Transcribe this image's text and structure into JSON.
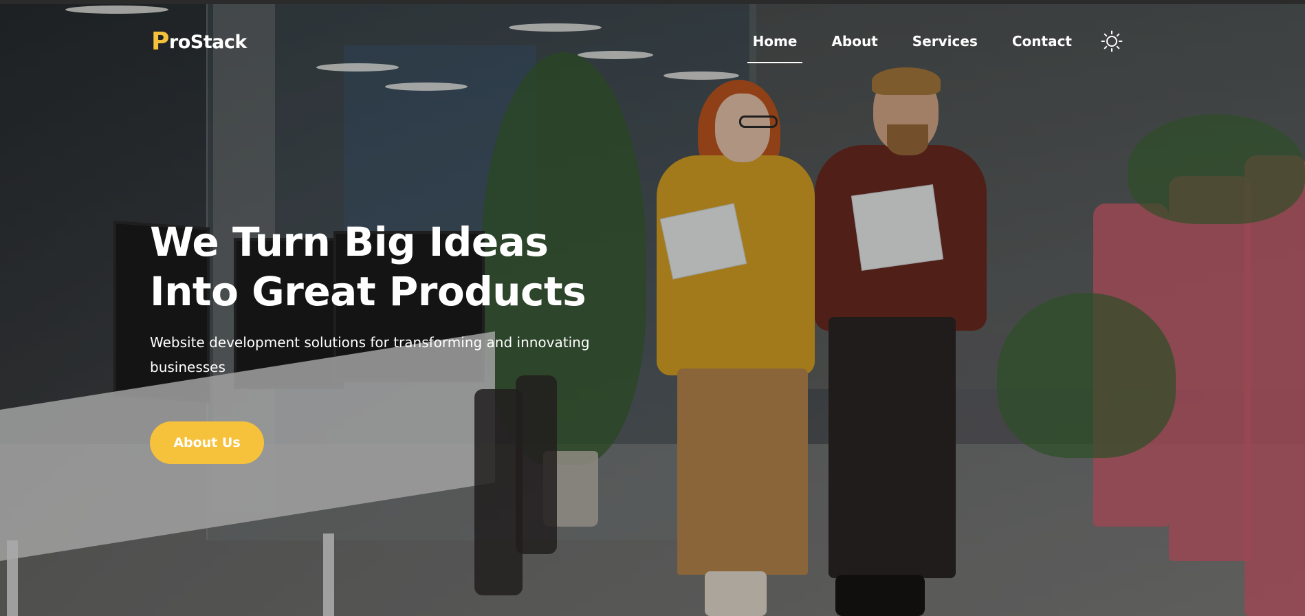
{
  "brand": {
    "logo_initial": "P",
    "logo_rest": "roStack",
    "accent_color": "#f7c23b"
  },
  "nav": {
    "items": [
      {
        "label": "Home",
        "active": true
      },
      {
        "label": "About",
        "active": false
      },
      {
        "label": "Services",
        "active": false
      },
      {
        "label": "Contact",
        "active": false
      }
    ],
    "theme_toggle_icon": "sun-icon"
  },
  "hero": {
    "headline_line1": "We Turn Big Ideas",
    "headline_line2": "Into Great Products",
    "subtitle": "Website development solutions for transforming and innovating businesses",
    "cta_label": "About Us",
    "background": "office-photo"
  }
}
